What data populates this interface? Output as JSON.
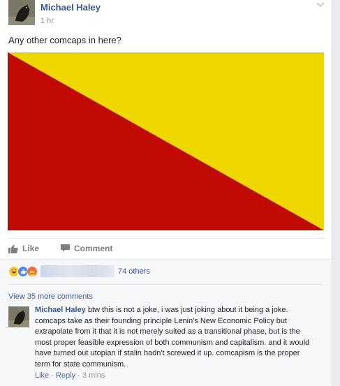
{
  "post": {
    "author": "Michael Haley",
    "time": "1 hr",
    "text": "Any other comcaps in here?",
    "image_colors": {
      "red": "#c10a02",
      "yellow": "#efd700"
    }
  },
  "actions": {
    "like": "Like",
    "comment": "Comment"
  },
  "reactions": {
    "icons": [
      "haha-icon",
      "like-icon",
      "angry-icon"
    ],
    "others": "74 others"
  },
  "comments": {
    "view_more": "View 35 more comments",
    "items": [
      {
        "author": "Michael Haley",
        "text": "btw this is not a joke, i was just joking about it being a joke. comcaps take as their founding principle Lenin's New Economic Policy but extrapolate from it that it is not merely suited as a transitional phase, but is the most proper feasible expression of both communism and capitalism. and it would have turned out utopian if stalin hadn't screwed it up. comcapism is the proper term for state communism.",
        "like": "Like",
        "reply": "Reply",
        "time": "3 mins"
      }
    ]
  }
}
